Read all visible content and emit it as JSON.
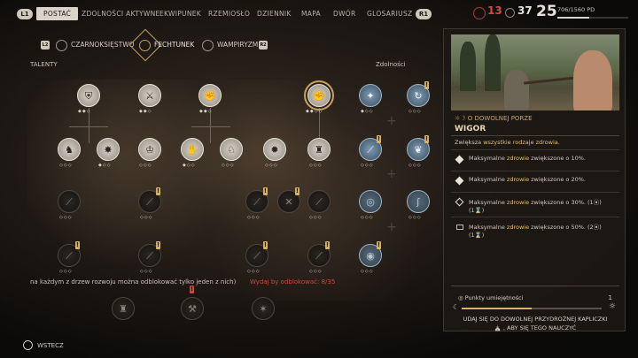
{
  "topnav": {
    "left_key": "L1",
    "right_key": "R1",
    "tabs": [
      "POSTAĆ",
      "ZDOLNOŚCI AKTYWNE",
      "EKWIPUNEK",
      "RZEMIOSŁO",
      "DZIENNIK",
      "MAPA",
      "DWÓR",
      "GLOSARIUSZ"
    ],
    "active_tab": "POSTAĆ"
  },
  "stats": {
    "health": "13",
    "health_color": "#d94a3e",
    "skill_points": "37",
    "level": "25",
    "xp": "706/1560 PD",
    "xp_fraction": 0.45
  },
  "categories": {
    "left_key": "L2",
    "right_key": "R2",
    "items": [
      "CZARNOKSIĘSTWO",
      "FECHTUNEK",
      "WAMPIRYZM"
    ],
    "active": "FECHTUNEK"
  },
  "sections": {
    "talents": "TALENTY",
    "skills": "Zdolności"
  },
  "tree_info": "na każdym z drzew rozwoju można odblokować tylko jeden z nich)",
  "tree_warn": "Wydaj  by odblokować: 8/35",
  "footer": {
    "back_label": "WSTECZ"
  },
  "panel": {
    "subtitle": "O DOWOLNEJ PORZE",
    "title": "WIGOR",
    "description_pre": "Zwiększa ",
    "description_hl": "wszystkie rodzaje zdrowia",
    "description_post": ".",
    "rows": [
      {
        "pre": "Maksymalne ",
        "hl": "zdrowie",
        "post": " zwiększone o 10%.",
        "sub": ""
      },
      {
        "pre": "Maksymalne ",
        "hl": "zdrowie",
        "post": " zwiększone o 20%.",
        "sub": ""
      },
      {
        "pre": "Maksymalne ",
        "hl": "zdrowie",
        "post": " zwiększone o 30%. (1",
        "sub": "(1"
      },
      {
        "pre": "Maksymalne ",
        "hl": "zdrowie",
        "post": " zwiększone o 50%. (2",
        "sub": "(1"
      }
    ],
    "points_label": "Punkty umiejętności",
    "points_value": "1",
    "points_progress": 0.5,
    "note1": "UDAJ SIĘ DO DOWOLNEJ PRZYDROŻNEJ KAPLICZKI",
    "note2": ", ABY SIĘ TEGO NAUCZYĆ"
  }
}
